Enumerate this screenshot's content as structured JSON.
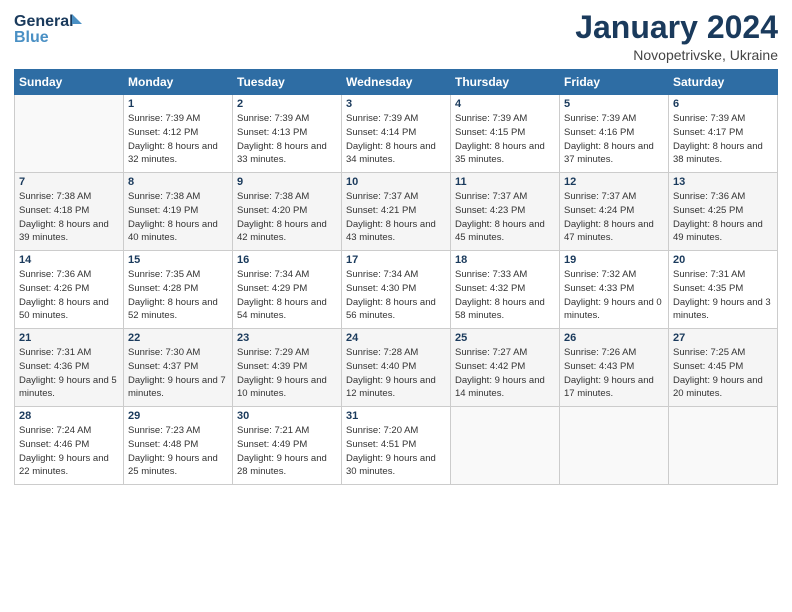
{
  "header": {
    "logo_line1": "General",
    "logo_line2": "Blue",
    "month_year": "January 2024",
    "location": "Novopetrivske, Ukraine"
  },
  "weekdays": [
    "Sunday",
    "Monday",
    "Tuesday",
    "Wednesday",
    "Thursday",
    "Friday",
    "Saturday"
  ],
  "weeks": [
    [
      {
        "day": "",
        "empty": true
      },
      {
        "day": "1",
        "sunrise": "7:39 AM",
        "sunset": "4:12 PM",
        "daylight": "8 hours and 32 minutes."
      },
      {
        "day": "2",
        "sunrise": "7:39 AM",
        "sunset": "4:13 PM",
        "daylight": "8 hours and 33 minutes."
      },
      {
        "day": "3",
        "sunrise": "7:39 AM",
        "sunset": "4:14 PM",
        "daylight": "8 hours and 34 minutes."
      },
      {
        "day": "4",
        "sunrise": "7:39 AM",
        "sunset": "4:15 PM",
        "daylight": "8 hours and 35 minutes."
      },
      {
        "day": "5",
        "sunrise": "7:39 AM",
        "sunset": "4:16 PM",
        "daylight": "8 hours and 37 minutes."
      },
      {
        "day": "6",
        "sunrise": "7:39 AM",
        "sunset": "4:17 PM",
        "daylight": "8 hours and 38 minutes."
      }
    ],
    [
      {
        "day": "7",
        "sunrise": "7:38 AM",
        "sunset": "4:18 PM",
        "daylight": "8 hours and 39 minutes."
      },
      {
        "day": "8",
        "sunrise": "7:38 AM",
        "sunset": "4:19 PM",
        "daylight": "8 hours and 40 minutes."
      },
      {
        "day": "9",
        "sunrise": "7:38 AM",
        "sunset": "4:20 PM",
        "daylight": "8 hours and 42 minutes."
      },
      {
        "day": "10",
        "sunrise": "7:37 AM",
        "sunset": "4:21 PM",
        "daylight": "8 hours and 43 minutes."
      },
      {
        "day": "11",
        "sunrise": "7:37 AM",
        "sunset": "4:23 PM",
        "daylight": "8 hours and 45 minutes."
      },
      {
        "day": "12",
        "sunrise": "7:37 AM",
        "sunset": "4:24 PM",
        "daylight": "8 hours and 47 minutes."
      },
      {
        "day": "13",
        "sunrise": "7:36 AM",
        "sunset": "4:25 PM",
        "daylight": "8 hours and 49 minutes."
      }
    ],
    [
      {
        "day": "14",
        "sunrise": "7:36 AM",
        "sunset": "4:26 PM",
        "daylight": "8 hours and 50 minutes."
      },
      {
        "day": "15",
        "sunrise": "7:35 AM",
        "sunset": "4:28 PM",
        "daylight": "8 hours and 52 minutes."
      },
      {
        "day": "16",
        "sunrise": "7:34 AM",
        "sunset": "4:29 PM",
        "daylight": "8 hours and 54 minutes."
      },
      {
        "day": "17",
        "sunrise": "7:34 AM",
        "sunset": "4:30 PM",
        "daylight": "8 hours and 56 minutes."
      },
      {
        "day": "18",
        "sunrise": "7:33 AM",
        "sunset": "4:32 PM",
        "daylight": "8 hours and 58 minutes."
      },
      {
        "day": "19",
        "sunrise": "7:32 AM",
        "sunset": "4:33 PM",
        "daylight": "9 hours and 0 minutes."
      },
      {
        "day": "20",
        "sunrise": "7:31 AM",
        "sunset": "4:35 PM",
        "daylight": "9 hours and 3 minutes."
      }
    ],
    [
      {
        "day": "21",
        "sunrise": "7:31 AM",
        "sunset": "4:36 PM",
        "daylight": "9 hours and 5 minutes."
      },
      {
        "day": "22",
        "sunrise": "7:30 AM",
        "sunset": "4:37 PM",
        "daylight": "9 hours and 7 minutes."
      },
      {
        "day": "23",
        "sunrise": "7:29 AM",
        "sunset": "4:39 PM",
        "daylight": "9 hours and 10 minutes."
      },
      {
        "day": "24",
        "sunrise": "7:28 AM",
        "sunset": "4:40 PM",
        "daylight": "9 hours and 12 minutes."
      },
      {
        "day": "25",
        "sunrise": "7:27 AM",
        "sunset": "4:42 PM",
        "daylight": "9 hours and 14 minutes."
      },
      {
        "day": "26",
        "sunrise": "7:26 AM",
        "sunset": "4:43 PM",
        "daylight": "9 hours and 17 minutes."
      },
      {
        "day": "27",
        "sunrise": "7:25 AM",
        "sunset": "4:45 PM",
        "daylight": "9 hours and 20 minutes."
      }
    ],
    [
      {
        "day": "28",
        "sunrise": "7:24 AM",
        "sunset": "4:46 PM",
        "daylight": "9 hours and 22 minutes."
      },
      {
        "day": "29",
        "sunrise": "7:23 AM",
        "sunset": "4:48 PM",
        "daylight": "9 hours and 25 minutes."
      },
      {
        "day": "30",
        "sunrise": "7:21 AM",
        "sunset": "4:49 PM",
        "daylight": "9 hours and 28 minutes."
      },
      {
        "day": "31",
        "sunrise": "7:20 AM",
        "sunset": "4:51 PM",
        "daylight": "9 hours and 30 minutes."
      },
      {
        "day": "",
        "empty": true
      },
      {
        "day": "",
        "empty": true
      },
      {
        "day": "",
        "empty": true
      }
    ]
  ],
  "labels": {
    "sunrise": "Sunrise:",
    "sunset": "Sunset:",
    "daylight": "Daylight:"
  }
}
